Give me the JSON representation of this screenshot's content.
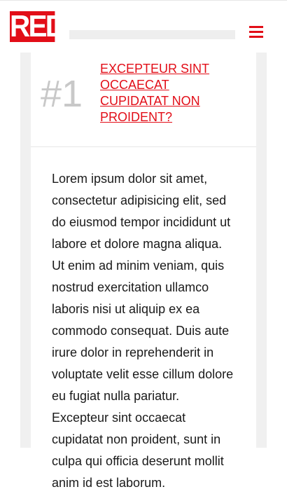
{
  "header": {
    "logo_text": "RED",
    "search_placeholder": "",
    "brand_color": "#e20e18"
  },
  "article": {
    "rank": "#1",
    "headline": "EXCEPTEUR SINT OCCAECAT CUPIDATAT NON PROIDENT?",
    "body": "Lorem ipsum dolor sit amet, consectetur adipisicing elit, sed do eiusmod tempor incididunt ut labore et dolore magna aliqua. Ut enim ad minim veniam, quis nostrud exercitation ullamco laboris nisi ut aliquip ex ea commodo consequat. Duis aute irure dolor in reprehenderit in voluptate velit esse cillum dolore eu fugiat nulla pariatur. Excepteur sint occaecat cupidatat non proident, sunt in culpa qui officia deserunt mollit anim id est laborum."
  },
  "icons": {
    "menu": "hamburger-menu-icon"
  }
}
